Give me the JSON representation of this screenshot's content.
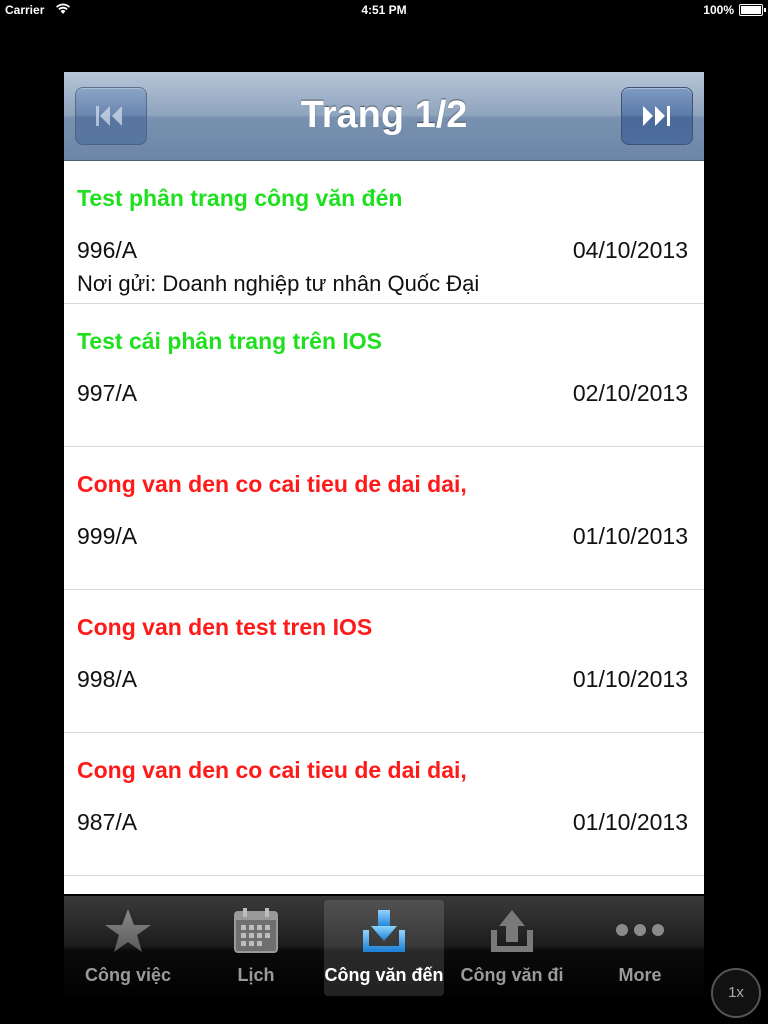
{
  "status_bar": {
    "carrier": "Carrier",
    "time": "4:51 PM",
    "battery": "100%"
  },
  "nav": {
    "title": "Trang 1/2",
    "first_icon": "rewind-to-start-icon",
    "last_icon": "fast-forward-to-end-icon"
  },
  "colors": {
    "read": "#1ee01e",
    "unread": "#ff1a1a",
    "nav_bar": "#7a92b1"
  },
  "items": [
    {
      "title": "Test phân trang công văn đén",
      "code": "996/A",
      "date": "04/10/2013",
      "sender": "Nơi gửi: Doanh nghiệp tư nhân Quốc Đại",
      "status": "read"
    },
    {
      "title": "Test cái phân trang trên IOS",
      "code": "997/A",
      "date": "02/10/2013",
      "sender": "",
      "status": "read"
    },
    {
      "title": "Cong van den co cai tieu de dai dai,",
      "code": "999/A",
      "date": "01/10/2013",
      "sender": "",
      "status": "unread"
    },
    {
      "title": "Cong van den test tren IOS",
      "code": "998/A",
      "date": "01/10/2013",
      "sender": "",
      "status": "unread"
    },
    {
      "title": "Cong van den co cai tieu de dai dai,",
      "code": "987/A",
      "date": "01/10/2013",
      "sender": "",
      "status": "unread"
    }
  ],
  "tabs": [
    {
      "label": "Công việc",
      "icon": "star-icon",
      "selected": false
    },
    {
      "label": "Lịch",
      "icon": "calendar-icon",
      "selected": false
    },
    {
      "label": "Công văn đến",
      "icon": "inbox-download-icon",
      "selected": true
    },
    {
      "label": "Công văn đi",
      "icon": "outbox-upload-icon",
      "selected": false
    },
    {
      "label": "More",
      "icon": "more-dots-icon",
      "selected": false
    }
  ],
  "zoom_badge": "1x"
}
